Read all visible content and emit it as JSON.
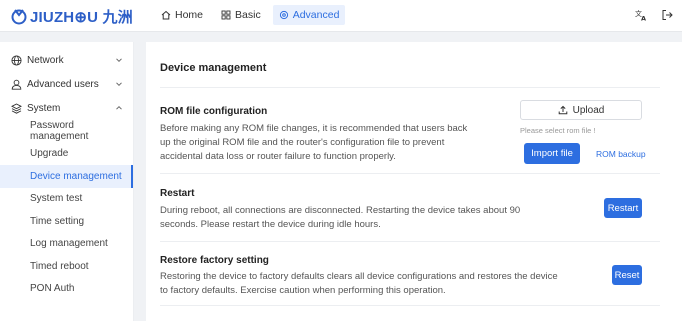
{
  "header": {
    "logo_text": "JIUZH⊕U 九洲",
    "nav": [
      {
        "label": "Home",
        "icon": "home-icon"
      },
      {
        "label": "Basic",
        "icon": "grid-icon"
      },
      {
        "label": "Advanced",
        "icon": "gear-icon"
      }
    ],
    "icons": [
      "translate-icon",
      "logout-icon"
    ],
    "accent": "#2d6ee0"
  },
  "sidebar": {
    "groups": [
      {
        "label": "Network",
        "icon": "globe-icon",
        "expanded": false
      },
      {
        "label": "Advanced users",
        "icon": "user-icon",
        "expanded": false
      },
      {
        "label": "System",
        "icon": "layers-icon",
        "expanded": true
      }
    ],
    "system_items": [
      "Password management",
      "Upgrade",
      "Device management",
      "System test",
      "Time setting",
      "Log management",
      "Timed reboot",
      "PON Auth"
    ],
    "active_item": "Device management"
  },
  "main": {
    "title": "Device management",
    "rom": {
      "title": "ROM file configuration",
      "desc": "Before making any ROM file changes, it is recommended that users back up the original ROM file and the router's configuration file to prevent accidental data loss or router failure to function properly.",
      "upload_label": "Upload",
      "hint": "Please select rom file !",
      "import_label": "Import file",
      "backup_label": "ROM backup"
    },
    "restart": {
      "title": "Restart",
      "desc": "During reboot, all connections are disconnected. Restarting the device takes about 90 seconds. Please restart the device during idle hours.",
      "button": "Restart"
    },
    "factory": {
      "title": "Restore factory setting",
      "desc": "Restoring the device to factory defaults clears all device configurations and restores the device to factory defaults. Exercise caution when performing this operation.",
      "button": "Reset"
    }
  }
}
